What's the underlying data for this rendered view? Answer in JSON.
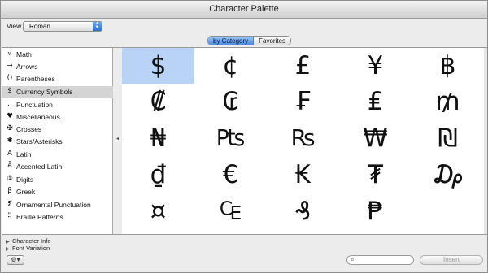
{
  "window": {
    "title": "Character Palette"
  },
  "view": {
    "label": "View :",
    "selected": "Roman"
  },
  "tabs": [
    {
      "label": "by Category",
      "active": true
    },
    {
      "label": "Favorites",
      "active": false
    }
  ],
  "categories": [
    {
      "icon": "√",
      "label": "Math"
    },
    {
      "icon": "→",
      "label": "Arrows"
    },
    {
      "icon": "()",
      "label": "Parentheses"
    },
    {
      "icon": "$",
      "label": "Currency Symbols",
      "selected": true
    },
    {
      "icon": ".,",
      "label": "Punctuation"
    },
    {
      "icon": "♥",
      "label": "Miscellaneous"
    },
    {
      "icon": "✠",
      "label": "Crosses"
    },
    {
      "icon": "✱",
      "label": "Stars/Asterisks"
    },
    {
      "icon": "A",
      "label": "Latin"
    },
    {
      "icon": "Ā",
      "label": "Accented Latin"
    },
    {
      "icon": "①",
      "label": "Digits"
    },
    {
      "icon": "β",
      "label": "Greek"
    },
    {
      "icon": "❡",
      "label": "Ornamental Punctuation"
    },
    {
      "icon": "⠿",
      "label": "Braille Patterns"
    }
  ],
  "characters": [
    [
      "$",
      "¢",
      "£",
      "¥",
      "฿"
    ],
    [
      "₡",
      "₢",
      "₣",
      "₤",
      "₥"
    ],
    [
      "₦",
      "₧",
      "₨",
      "₩",
      "₪"
    ],
    [
      "₫",
      "€",
      "₭",
      "₮",
      "₯"
    ],
    [
      "¤",
      "₠",
      "₰",
      "₱",
      ""
    ]
  ],
  "selected_character": "$",
  "expanders": [
    {
      "label": "Character Info"
    },
    {
      "label": "Font Variation"
    }
  ],
  "bottom": {
    "gear_label": "⚙▾",
    "insert_label": "Insert",
    "search_placeholder": ""
  },
  "colors": {
    "selection": "#b8d3f6",
    "tab_active": "#4a8be2"
  }
}
